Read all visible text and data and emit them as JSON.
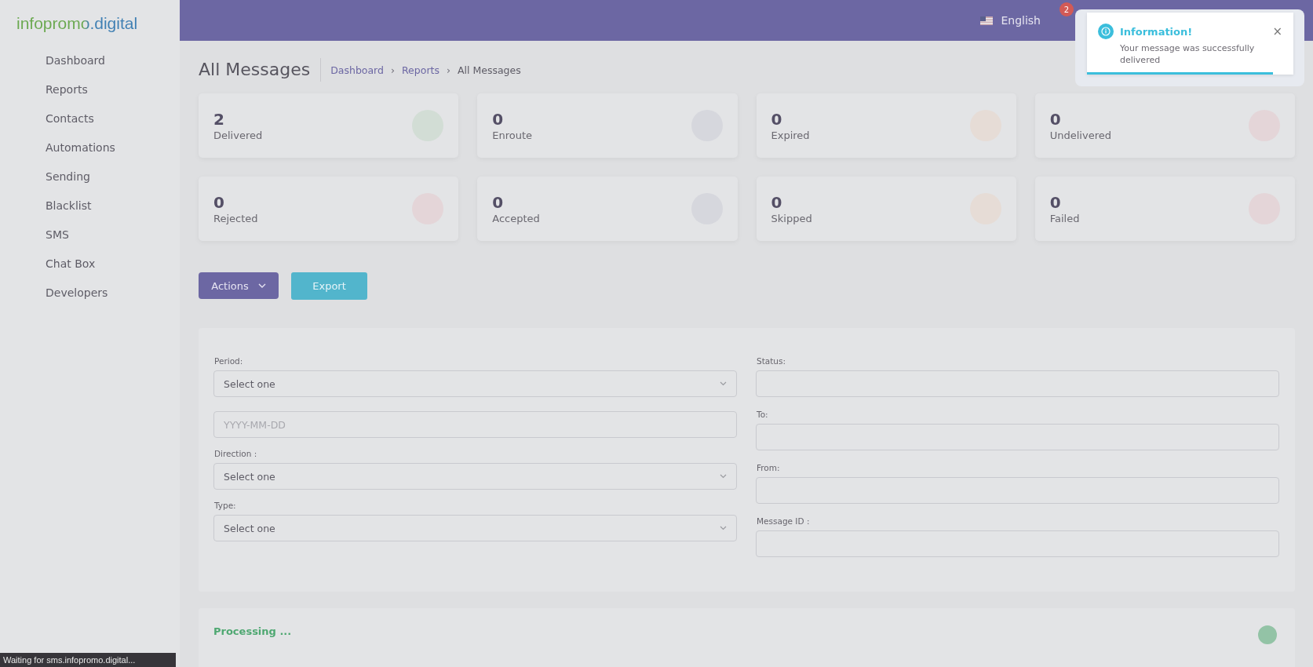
{
  "sidebar": {
    "logo": "infopromo.digital",
    "items": [
      {
        "label": "Dashboard"
      },
      {
        "label": "Reports"
      },
      {
        "label": "Contacts"
      },
      {
        "label": "Automations"
      },
      {
        "label": "Sending"
      },
      {
        "label": "Blacklist"
      },
      {
        "label": "SMS"
      },
      {
        "label": "Chat Box"
      },
      {
        "label": "Developers"
      }
    ]
  },
  "topbar": {
    "language": "English",
    "notification_count": "2"
  },
  "page": {
    "title": "All Messages",
    "breadcrumb": [
      {
        "label": "Dashboard",
        "link": true
      },
      {
        "label": "Reports",
        "link": true
      },
      {
        "label": "All Messages",
        "link": false
      }
    ],
    "separator": "›"
  },
  "stats": [
    {
      "value": "2",
      "label": "Delivered",
      "color": "#d2ddd5"
    },
    {
      "value": "0",
      "label": "Enroute",
      "color": "#d6d7dd"
    },
    {
      "value": "0",
      "label": "Expired",
      "color": "#e6dcd6"
    },
    {
      "value": "0",
      "label": "Undelivered",
      "color": "#e4d5d8"
    },
    {
      "value": "0",
      "label": "Rejected",
      "color": "#e4d5d8"
    },
    {
      "value": "0",
      "label": "Accepted",
      "color": "#d6d7dd"
    },
    {
      "value": "0",
      "label": "Skipped",
      "color": "#e6dcd6"
    },
    {
      "value": "0",
      "label": "Failed",
      "color": "#e4d5d8"
    }
  ],
  "actions": {
    "primary": "Actions",
    "export": "Export"
  },
  "filters": {
    "left": [
      {
        "label": "Period:",
        "kind": "select",
        "value": "Select one"
      },
      {
        "kind": "date",
        "placeholder": "YYYY-MM-DD"
      },
      {
        "label": "Direction :",
        "kind": "select",
        "value": "Select one"
      },
      {
        "label": "Type:",
        "kind": "select",
        "value": "Select one"
      }
    ],
    "right": [
      {
        "label": "Status:",
        "kind": "text"
      },
      {
        "label": "To:",
        "kind": "text"
      },
      {
        "label": "From:",
        "kind": "text"
      },
      {
        "label": "Message ID :",
        "kind": "text"
      }
    ]
  },
  "processing": {
    "text": "Processing ..."
  },
  "toast": {
    "title": "Information!",
    "message": "Your message was successfully delivered",
    "close": "×",
    "level": 0.9
  },
  "status_bar": {
    "text": "Waiting for sms.infopromo.digital..."
  }
}
